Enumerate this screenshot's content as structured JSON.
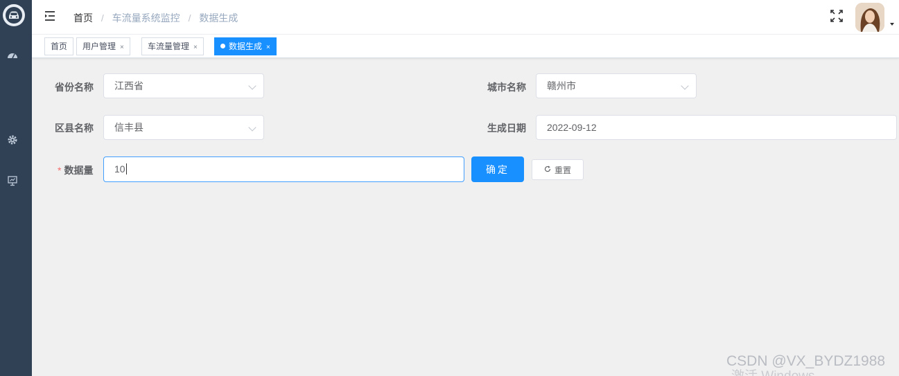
{
  "sidebar": {
    "logo_icon": "car-icon",
    "items": [
      {
        "icon": "dashboard-icon"
      },
      {
        "icon": "gear-icon"
      },
      {
        "icon": "monitor-icon"
      }
    ],
    "bg_color": "#304156"
  },
  "header": {
    "menu_icon": "hamburger-icon",
    "breadcrumb": [
      "首页",
      "车流量系统监控",
      "数据生成"
    ],
    "separator": "/",
    "fullscreen_icon": "fullscreen-icon",
    "avatar_icon": "avatar"
  },
  "tags": [
    {
      "label": "首页",
      "closable": false,
      "active": false
    },
    {
      "label": "用户管理",
      "closable": true,
      "active": false
    },
    {
      "label": "车流量管理",
      "closable": true,
      "active": false
    },
    {
      "label": "数据生成",
      "closable": true,
      "active": true
    }
  ],
  "tag_close_symbol": "×",
  "form": {
    "province": {
      "label": "省份名称",
      "value": "江西省"
    },
    "city": {
      "label": "城市名称",
      "value": "赣州市"
    },
    "district": {
      "label": "区县名称",
      "value": "信丰县"
    },
    "date": {
      "label": "生成日期",
      "value": "2022-09-12"
    },
    "count": {
      "label": "数据量",
      "required_mark": "*",
      "value": "10"
    },
    "confirm_label": "确定",
    "reset_label": "重置",
    "reset_icon": "refresh-icon"
  },
  "watermark": {
    "text": "CSDN @VX_BYDZ1988",
    "activation_text": "激活 Windows"
  },
  "colors": {
    "accent": "#1890ff",
    "required": "#f56c6c"
  }
}
